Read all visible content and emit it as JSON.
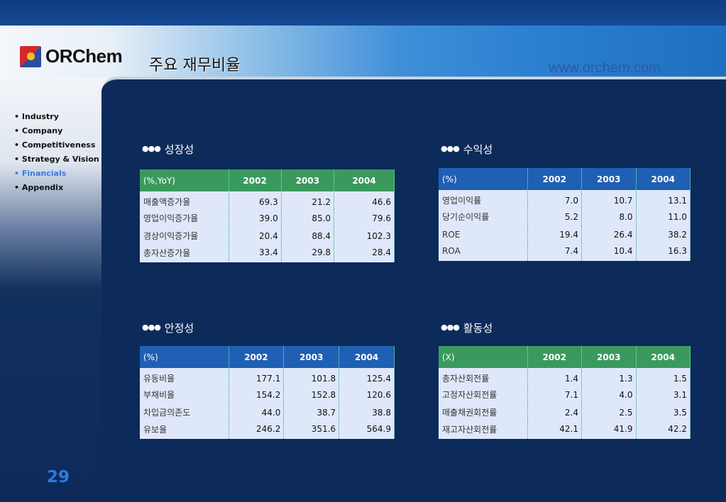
{
  "header": {
    "logo": "ORChem",
    "title": "주요 재무비율",
    "url": "www.orchem.com"
  },
  "nav": [
    {
      "label": "Industry"
    },
    {
      "label": "Company"
    },
    {
      "label": "Competitiveness"
    },
    {
      "label": "Strategy & Vision"
    },
    {
      "label": "Financials",
      "active": true
    },
    {
      "label": "Appendix"
    }
  ],
  "page_number": "29",
  "colors": {
    "green_header": "#3a9a5e",
    "blue_header": "#1f5fb4",
    "active_nav": "#3a7ae8"
  },
  "sections": [
    {
      "title": "성장성",
      "unit": "(%,YoY)",
      "years": [
        "2002",
        "2003",
        "2004"
      ],
      "rows": [
        [
          "매출액증가율",
          "69.3",
          "21.2",
          "46.6"
        ],
        [
          "영업이익증가율",
          "39.0",
          "85.0",
          "79.6"
        ],
        [
          "경상이익증가율",
          "20.4",
          "88.4",
          "102.3"
        ],
        [
          "총자산증가율",
          "33.4",
          "29.8",
          "28.4"
        ]
      ]
    },
    {
      "title": "수익성",
      "unit": "(%)",
      "years": [
        "2002",
        "2003",
        "2004"
      ],
      "rows": [
        [
          "영업이익률",
          "7.0",
          "10.7",
          "13.1"
        ],
        [
          "당기순이익률",
          "5.2",
          "8.0",
          "11.0"
        ],
        [
          "ROE",
          "19.4",
          "26.4",
          "38.2"
        ],
        [
          "ROA",
          "7.4",
          "10.4",
          "16.3"
        ]
      ]
    },
    {
      "title": "안정성",
      "unit": "(%)",
      "years": [
        "2002",
        "2003",
        "2004"
      ],
      "rows": [
        [
          "유동비율",
          "177.1",
          "101.8",
          "125.4"
        ],
        [
          "부채비율",
          "154.2",
          "152.8",
          "120.6"
        ],
        [
          "차입금의존도",
          "44.0",
          "38.7",
          "38.8"
        ],
        [
          "유보율",
          "246.2",
          "351.6",
          "564.9"
        ]
      ]
    },
    {
      "title": "활동성",
      "unit": "(X)",
      "years": [
        "2002",
        "2003",
        "2004"
      ],
      "rows": [
        [
          "총자산회전률",
          "1.4",
          "1.3",
          "1.5"
        ],
        [
          "고정자산회전률",
          "7.1",
          "4.0",
          "3.1"
        ],
        [
          "매출채권회전률",
          "2.4",
          "2.5",
          "3.5"
        ],
        [
          "재고자산회전률",
          "42.1",
          "41.9",
          "42.2"
        ]
      ]
    }
  ]
}
